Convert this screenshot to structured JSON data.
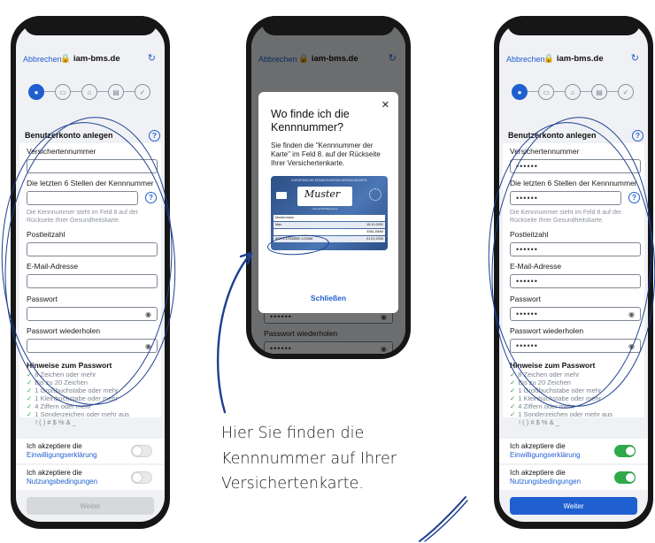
{
  "common": {
    "cancel_label": "Abbrechen",
    "url": "iam-bms.de",
    "reload_glyph": "↻",
    "step_icons": [
      "person-icon",
      "id-card-icon",
      "lock-icon",
      "card-icon",
      "check-icon"
    ],
    "accent": "#1f5fd0",
    "scribble_color": "#1d3f8f",
    "switch_on_color": "#2eaa4a"
  },
  "form": {
    "section_title": "Benutzerkonto anlegen",
    "help_glyph": "?",
    "fields": {
      "insurance_number_label": "Versichertennummer",
      "last6_label": "Die letzten 6 Stellen der Kennnummer",
      "last6_hint": "Die Kennnummer steht im Feld 8 auf der Rückseite Ihrer Gesundheitskarte.",
      "zip_label": "Postleitzahl",
      "email_label": "E-Mail-Adresse",
      "password_label": "Passwort",
      "password_repeat_label": "Passwort wiederholen"
    },
    "masked_value": "••••••",
    "eye_glyph": "◉",
    "password_hints": {
      "title": "Hinweise zum Passwort",
      "rules": [
        "8 Zeichen oder mehr",
        "Bis zu 20 Zeichen",
        "1 Großbuchstabe oder mehr",
        "1 Kleinbuchstabe oder mehr",
        "4 Ziffern oder mehr",
        "1 Sonderzeichen oder mehr aus"
      ],
      "special_chars": "! ( ) # $ % & _"
    },
    "consent": {
      "accept_label": "Ich akzeptiere die",
      "einwilligung_link": "Einwilligungserklärung",
      "nutzung_link": "Nutzungsbedingungen"
    },
    "next_button": "Weiter"
  },
  "phone_left": {
    "toggles_on": false,
    "fields_filled": false
  },
  "phone_right": {
    "toggles_on": true,
    "fields_filled": true
  },
  "modal": {
    "title": "Wo finde ich die Kennnummer?",
    "text": "Sie finden die \"Kennnummer der Karte\" im Feld 8. auf der Rückseite Ihrer Versichertenkarte.",
    "close_glyph": "✕",
    "close_button": "Schließen",
    "card": {
      "header": "EUROPÄISCHE KRANKENVERSICHERUNGSKARTE",
      "signature": "Muster",
      "signature_caption": "Unterschrift/Signature",
      "rows": [
        [
          "Mustermann",
          ""
        ],
        [
          "Max",
          "15.10.2001"
        ],
        [
          "",
          "4561-BMM"
        ],
        [
          "80276 12345680 123456",
          "01.01.2026"
        ]
      ]
    }
  },
  "caption": {
    "lines": [
      "Hier Sie finden die",
      "Kennnummer auf Ihrer",
      "Versichertenkarte."
    ]
  }
}
